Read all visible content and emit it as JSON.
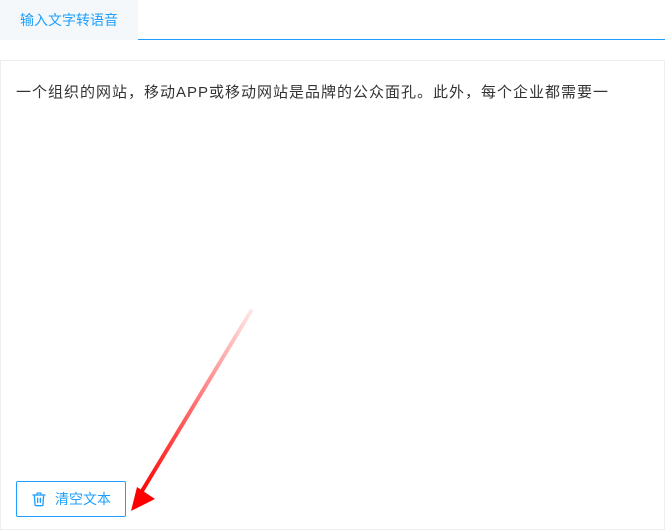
{
  "tabs": {
    "items": [
      {
        "label": "输入文字转语音",
        "active": true
      }
    ]
  },
  "editor": {
    "text": "一个组织的网站，移动APP或移动网站是品牌的公众面孔。此外，每个企业都需要一"
  },
  "actions": {
    "clear_label": "清空文本"
  },
  "colors": {
    "primary": "#1E9FFF",
    "arrow": "#FF0000"
  }
}
